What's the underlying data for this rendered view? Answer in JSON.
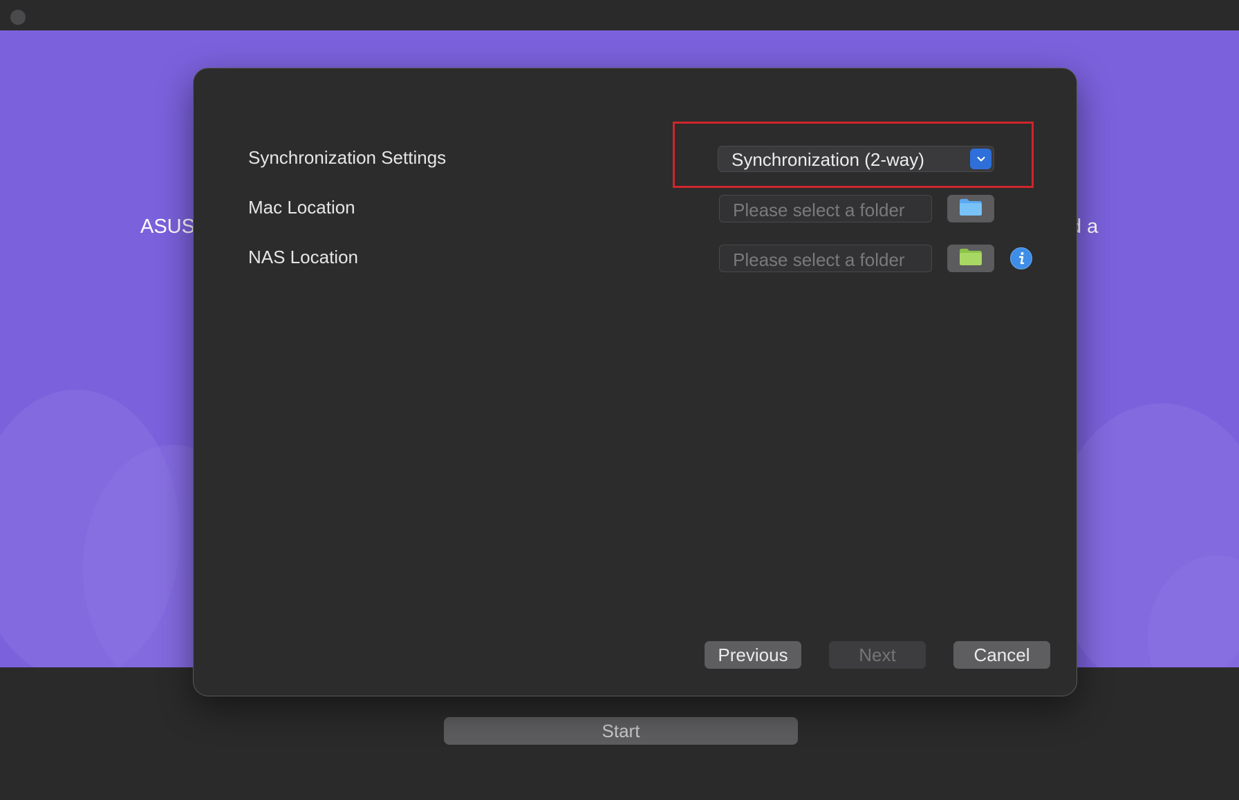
{
  "banner": {
    "text_left": "ASUS",
    "text_right": "d a"
  },
  "dialog": {
    "rows": [
      {
        "label": "Synchronization Settings"
      },
      {
        "label": "Mac Location"
      },
      {
        "label": "NAS Location"
      }
    ],
    "sync_mode": {
      "value": "Synchronization (2-way)"
    },
    "mac_location": {
      "placeholder": "Please select a folder",
      "folder_icon": "folder-blue-icon",
      "folder_color": "#68b8f5"
    },
    "nas_location": {
      "placeholder": "Please select a folder",
      "folder_icon": "folder-green-icon",
      "folder_color": "#a4d65e"
    },
    "info_icon": "info-icon",
    "buttons": {
      "previous": "Previous",
      "next": "Next",
      "cancel": "Cancel"
    },
    "highlight_color": "#d0262b"
  },
  "footer": {
    "start_label": "Start"
  },
  "colors": {
    "banner": "#7b61dc",
    "dialog_bg": "#2c2c2c",
    "accent": "#2e6fd9"
  }
}
